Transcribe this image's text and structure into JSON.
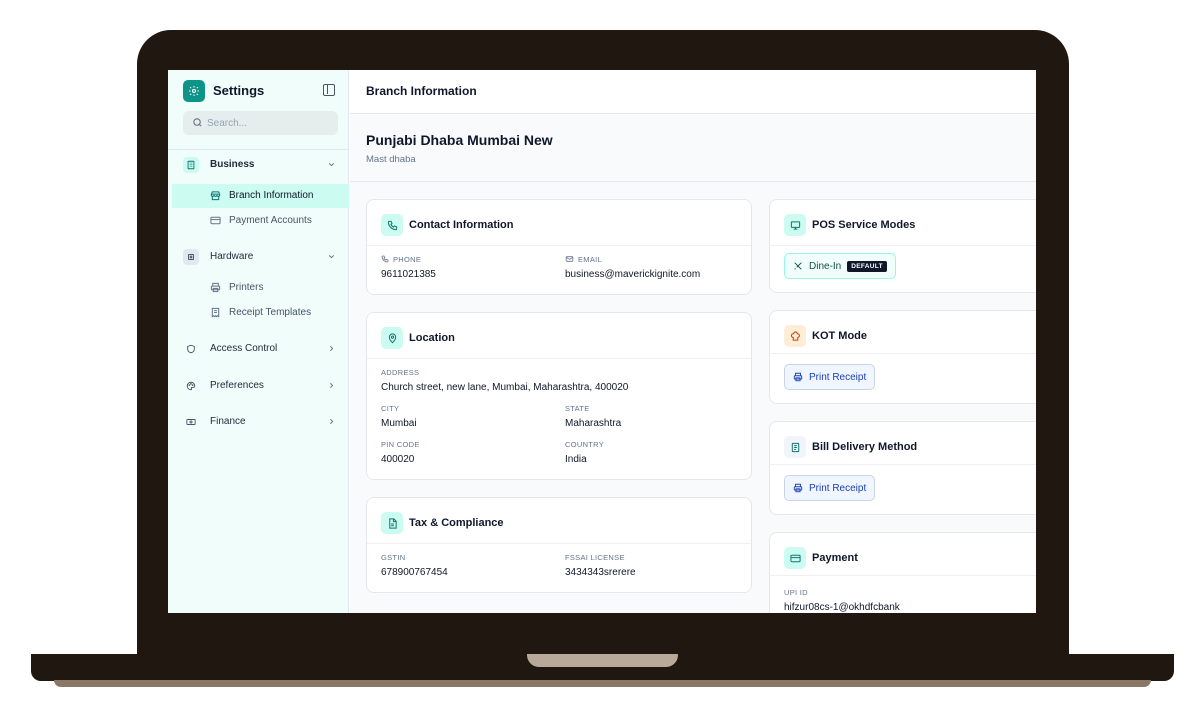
{
  "sidebar": {
    "title": "Settings",
    "search_placeholder": "Search...",
    "groups": [
      {
        "label": "Business",
        "items": [
          {
            "label": "Branch Information"
          },
          {
            "label": "Payment Accounts"
          }
        ]
      },
      {
        "label": "Hardware",
        "items": [
          {
            "label": "Printers"
          },
          {
            "label": "Receipt Templates"
          }
        ]
      },
      {
        "label": "Access Control"
      },
      {
        "label": "Preferences"
      },
      {
        "label": "Finance"
      }
    ]
  },
  "main": {
    "page_title": "Branch Information",
    "branch_name": "Punjabi Dhaba Mumbai New",
    "branch_subtitle": "Mast dhaba",
    "contact": {
      "title": "Contact Information",
      "phone_label": "PHONE",
      "phone": "9611021385",
      "email_label": "EMAIL",
      "email": "business@maverickignite.com"
    },
    "location": {
      "title": "Location",
      "address_label": "ADDRESS",
      "address": "Church street, new lane, Mumbai, Maharashtra, 400020",
      "city_label": "CITY",
      "city": "Mumbai",
      "state_label": "STATE",
      "state": "Maharashtra",
      "pincode_label": "PIN CODE",
      "pincode": "400020",
      "country_label": "COUNTRY",
      "country": "India"
    },
    "tax": {
      "title": "Tax & Compliance",
      "gstin_label": "GSTIN",
      "gstin": "678900767454",
      "fssai_label": "FSSAI LICENSE",
      "fssai": "3434343srerere"
    },
    "pos": {
      "title": "POS Service Modes",
      "mode": "Dine-In",
      "badge": "DEFAULT"
    },
    "kot": {
      "title": "KOT Mode",
      "option": "Print Receipt"
    },
    "bill": {
      "title": "Bill Delivery Method",
      "option": "Print Receipt"
    },
    "payment": {
      "title": "Payment",
      "upi_label": "UPI ID",
      "upi": "hifzur08cs-1@okhdfcbank"
    }
  },
  "colors": {
    "accent": "#0d9488",
    "sidebar_bg": "#f0fdfa",
    "active_item": "#ccfbf1",
    "frame": "#1f1710"
  }
}
